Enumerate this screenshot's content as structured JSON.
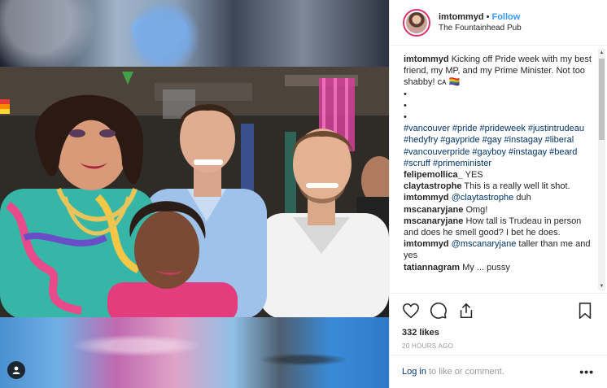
{
  "post": {
    "username": "imtommyd",
    "dot": "•",
    "follow_label": "Follow",
    "location": "The Fountainhead Pub",
    "likes": "332 likes",
    "time": "20 HOURS AGO",
    "login_link": "Log in",
    "login_rest": "to like or comment.",
    "more": "•••"
  },
  "caption": {
    "username": "imtommyd",
    "text": "Kicking off Pride week with my best friend, my MP, and my Prime Minister. Not too shabby! ᴄᴀ 🏳️‍🌈",
    "bullets": [
      "•",
      "•",
      "•"
    ],
    "hashtags": "#vancouver #pride #prideweek #justintrudeau #hedyfry #gaypride #gay #instagay #liberal #vancouverpride #gayboy #instagay #beard #scruff #primeminister"
  },
  "comments": [
    {
      "user": "felipemollica_",
      "text": "YES",
      "mention": ""
    },
    {
      "user": "claytastrophe",
      "text": "This is a really well lit shot.",
      "mention": ""
    },
    {
      "user": "imtommyd",
      "mention": "@claytastrophe",
      "text": "duh"
    },
    {
      "user": "mscanaryjane",
      "text": "Omg!",
      "mention": ""
    },
    {
      "user": "mscanaryjane",
      "text": "How tall is Trudeau in person and does he smell good? I bet he does.",
      "mention": ""
    },
    {
      "user": "imtommyd",
      "mention": "@mscanaryjane",
      "text": "taller than me and yes"
    },
    {
      "user": "tatiannagram",
      "text": "My ... pussy",
      "mention": ""
    }
  ],
  "icons": [
    "heart-icon",
    "comment-icon",
    "share-icon",
    "bookmark-icon",
    "user-tag-icon"
  ],
  "colors": {
    "follow": "#3897f0",
    "link": "#003569",
    "muted": "#999999",
    "story_ring": "#e1306c"
  }
}
